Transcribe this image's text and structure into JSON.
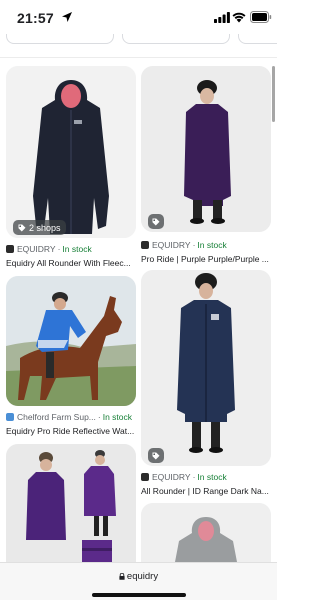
{
  "status_bar": {
    "time": "21:57"
  },
  "cards": [
    {
      "badge": "2 shops",
      "seller": "EQUIDRY",
      "stock": "In stock",
      "title": "Equidry All Rounder With Fleec..."
    },
    {
      "seller": "EQUIDRY",
      "stock": "In stock",
      "title": "Pro Ride | Purple Purple/Purple ..."
    },
    {
      "seller": "Chelford Farm Sup...",
      "stock": "In stock",
      "title": "Equidry Pro Ride Reflective Wat..."
    },
    {
      "seller": "EQUIDRY",
      "stock": "In stock",
      "title": "All Rounder | ID Range Dark Na..."
    }
  ],
  "separator": "·",
  "address_bar": {
    "domain": "equidry"
  },
  "icons": [
    "location-arrow-icon",
    "signal-icon",
    "wifi-icon",
    "battery-icon",
    "tag-icon",
    "lock-icon"
  ]
}
